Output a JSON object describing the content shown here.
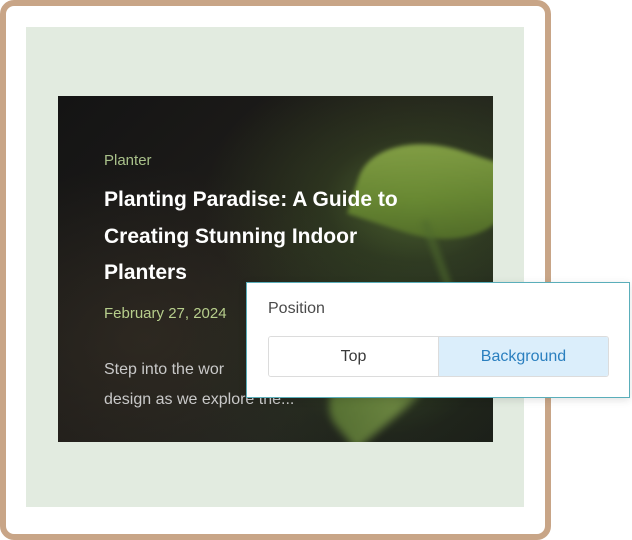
{
  "card": {
    "category": "Planter",
    "title": "Planting Paradise: A Guide to Creating Stunning Indoor Planters",
    "date": "February 27, 2024",
    "excerpt": "Step into the wor... design as we explore the..."
  },
  "popover": {
    "label": "Position",
    "options": [
      {
        "label": "Top",
        "selected": false
      },
      {
        "label": "Background",
        "selected": true
      }
    ]
  },
  "colors": {
    "frame_border": "#c8a587",
    "canvas_bg": "#e2ebe0",
    "popover_border": "#5aaeba",
    "selected_bg": "#dbeefb",
    "selected_text": "#2a7fbf",
    "category_text": "#a9c18a"
  }
}
